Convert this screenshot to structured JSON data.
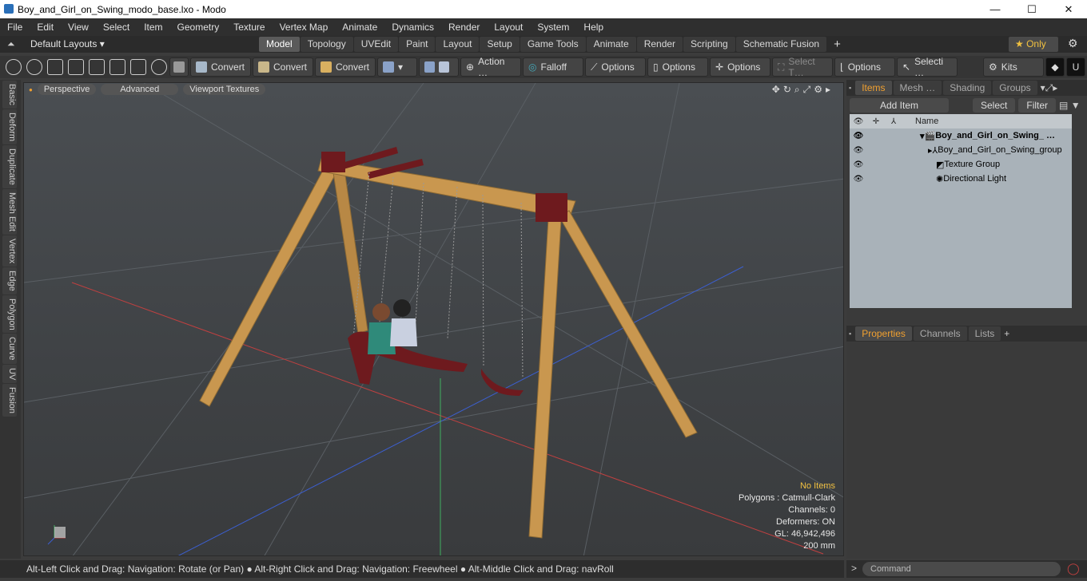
{
  "window": {
    "title": "Boy_and_Girl_on_Swing_modo_base.lxo - Modo",
    "minimize": "—",
    "maximize": "☐",
    "close": "✕"
  },
  "menu": [
    "File",
    "Edit",
    "View",
    "Select",
    "Item",
    "Geometry",
    "Texture",
    "Vertex Map",
    "Animate",
    "Dynamics",
    "Render",
    "Layout",
    "System",
    "Help"
  ],
  "layout": {
    "default_layouts": "Default Layouts ▾",
    "tabs": [
      "Model",
      "Topology",
      "UVEdit",
      "Paint",
      "Layout",
      "Setup",
      "Game Tools",
      "Animate",
      "Render",
      "Scripting",
      "Schematic Fusion"
    ],
    "active_tab": "Model",
    "add": "+",
    "only": "★  Only"
  },
  "toolbar": {
    "convert1": "Convert",
    "convert2": "Convert",
    "convert3": "Convert",
    "action": "Action  …",
    "falloff": "Falloff",
    "options1": "Options",
    "options2": "Options",
    "options3": "Options",
    "select_t": "Select T…",
    "options4": "Options",
    "selecti": "Selecti …",
    "kits": "Kits"
  },
  "left_tabs": [
    "Basic",
    "Deform",
    "Duplicate",
    "Mesh Edit",
    "Vertex",
    "Edge",
    "Polygon",
    "Curve",
    "UV",
    "Fusion"
  ],
  "viewport": {
    "perspective": "Perspective",
    "advanced": "Advanced",
    "textures": "Viewport Textures",
    "info": {
      "no_items": "No Items",
      "polygons": "Polygons : Catmull-Clark",
      "channels": "Channels: 0",
      "deformers": "Deformers: ON",
      "gl": "GL: 46,942,496",
      "scale": "200 mm"
    }
  },
  "status": "Alt-Left Click and Drag: Navigation: Rotate (or Pan) ● Alt-Right Click and Drag: Navigation: Freewheel ● Alt-Middle Click and Drag: navRoll",
  "items_panel": {
    "tabs": [
      "Items",
      "Mesh …",
      "Shading",
      "Groups"
    ],
    "add_item": "Add Item",
    "select": "Select",
    "filter": "Filter",
    "name_col": "Name",
    "rows": [
      {
        "label": "Boy_and_Girl_on_Swing_ …"
      },
      {
        "label": "Boy_and_Girl_on_Swing_group"
      },
      {
        "label": "Texture Group"
      },
      {
        "label": "Directional Light"
      }
    ]
  },
  "props_panel": {
    "tabs": [
      "Properties",
      "Channels",
      "Lists"
    ],
    "add": "+"
  },
  "command": {
    "placeholder": "Command"
  },
  "colors": {
    "accent": "#f0a030",
    "wood": "#c9974f",
    "metal": "#6e1a1e"
  }
}
